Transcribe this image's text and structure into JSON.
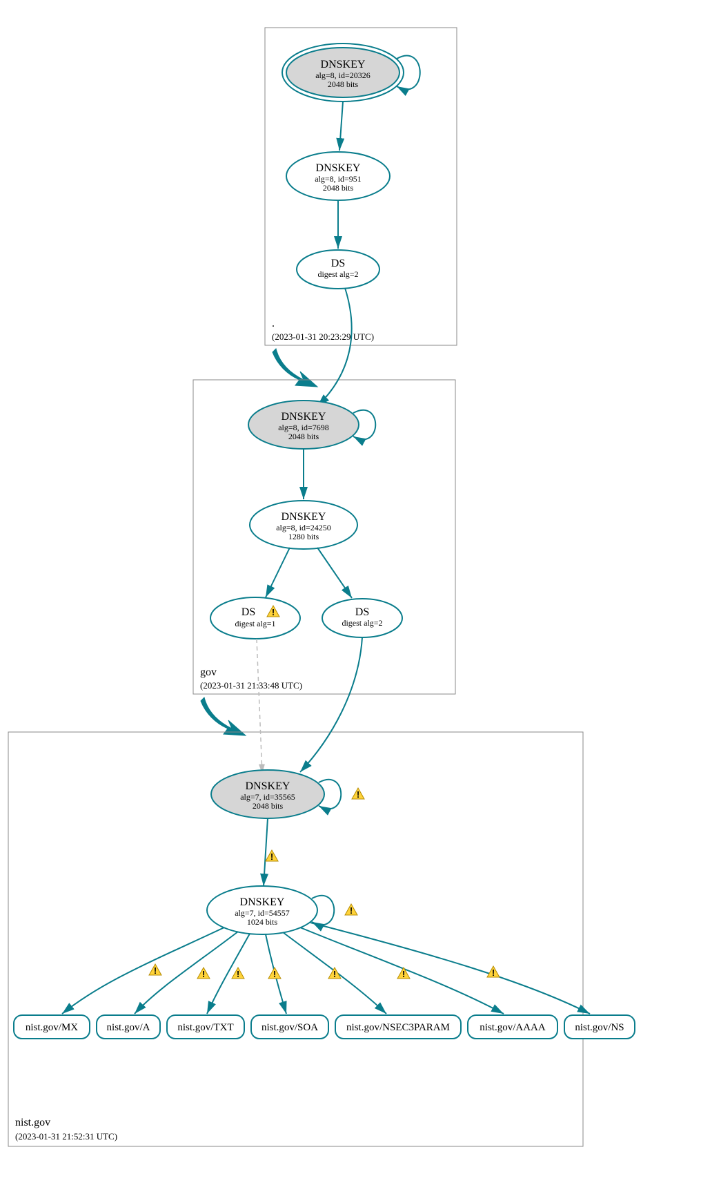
{
  "diagram": {
    "zones": {
      "root": {
        "name": ".",
        "timestamp": "(2023-01-31 20:23:29 UTC)"
      },
      "gov": {
        "name": "gov",
        "timestamp": "(2023-01-31 21:33:48 UTC)"
      },
      "nist": {
        "name": "nist.gov",
        "timestamp": "(2023-01-31 21:52:31 UTC)"
      }
    },
    "nodes": {
      "root_ksk": {
        "title": "DNSKEY",
        "line1": "alg=8, id=20326",
        "line2": "2048 bits"
      },
      "root_zsk": {
        "title": "DNSKEY",
        "line1": "alg=8, id=951",
        "line2": "2048 bits"
      },
      "root_ds": {
        "title": "DS",
        "line1": "digest alg=2"
      },
      "gov_ksk": {
        "title": "DNSKEY",
        "line1": "alg=8, id=7698",
        "line2": "2048 bits"
      },
      "gov_zsk": {
        "title": "DNSKEY",
        "line1": "alg=8, id=24250",
        "line2": "1280 bits"
      },
      "gov_ds1": {
        "title": "DS",
        "line1": "digest alg=1"
      },
      "gov_ds2": {
        "title": "DS",
        "line1": "digest alg=2"
      },
      "nist_ksk": {
        "title": "DNSKEY",
        "line1": "alg=7, id=35565",
        "line2": "2048 bits"
      },
      "nist_zsk": {
        "title": "DNSKEY",
        "line1": "alg=7, id=54557",
        "line2": "1024 bits"
      }
    },
    "rr": {
      "mx": "nist.gov/MX",
      "a": "nist.gov/A",
      "txt": "nist.gov/TXT",
      "soa": "nist.gov/SOA",
      "nsec": "nist.gov/NSEC3PARAM",
      "aaaa": "nist.gov/AAAA",
      "ns": "nist.gov/NS"
    }
  }
}
